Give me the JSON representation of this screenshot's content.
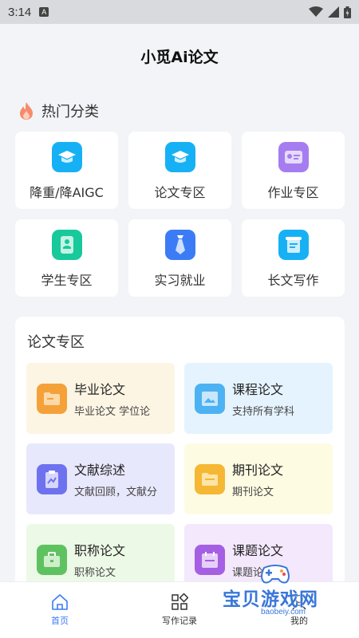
{
  "status_bar": {
    "time": "3:14",
    "notification_badge": "A"
  },
  "header": {
    "title": "小觅Ai论文"
  },
  "hot_section": {
    "title": "热门分类",
    "icon": "fire-icon"
  },
  "categories": [
    {
      "label": "降重/降AIGC",
      "icon": "graduation-cap-icon",
      "color": "#16b1f5"
    },
    {
      "label": "论文专区",
      "icon": "graduation-cap-icon",
      "color": "#16b1f5"
    },
    {
      "label": "作业专区",
      "icon": "id-card-icon",
      "color": "#a57df0"
    },
    {
      "label": "学生专区",
      "icon": "student-card-icon",
      "color": "#17c99b"
    },
    {
      "label": "实习就业",
      "icon": "tie-icon",
      "color": "#3b7cf6"
    },
    {
      "label": "长文写作",
      "icon": "scroll-icon",
      "color": "#16b1f5"
    }
  ],
  "paper_section": {
    "title": "论文专区",
    "items": [
      {
        "title": "毕业论文",
        "desc": "毕业论文 学位论",
        "icon": "folder-icon",
        "icon_color": "#f5a13a",
        "bg": "#fdf5e4"
      },
      {
        "title": "课程论文",
        "desc": "支持所有学科",
        "icon": "picture-icon",
        "icon_color": "#4db2f2",
        "bg": "#e5f3fe"
      },
      {
        "title": "文献综述",
        "desc": "文献回顾，文献分",
        "icon": "clipboard-icon",
        "icon_color": "#6f72ee",
        "bg": "#e8e8fd"
      },
      {
        "title": "期刊论文",
        "desc": "期刊论文",
        "icon": "folder-icon",
        "icon_color": "#f6b734",
        "bg": "#fdfbe2"
      },
      {
        "title": "职称论文",
        "desc": "职称论文",
        "icon": "briefcase-icon",
        "icon_color": "#5fc261",
        "bg": "#edf9e7"
      },
      {
        "title": "课题论文",
        "desc": "课题论",
        "icon": "calendar-icon",
        "icon_color": "#a55fe3",
        "bg": "#f4e8fc"
      }
    ]
  },
  "tabbar": {
    "tabs": [
      {
        "label": "首页",
        "icon": "home-icon",
        "active": true
      },
      {
        "label": "写作记录",
        "icon": "grid-icon",
        "active": false
      },
      {
        "label": "我的",
        "icon": "user-icon",
        "active": false
      }
    ],
    "accent": "#3b7cf6"
  },
  "watermark": {
    "text": "宝贝游戏网",
    "url": "baobeiy.com"
  }
}
